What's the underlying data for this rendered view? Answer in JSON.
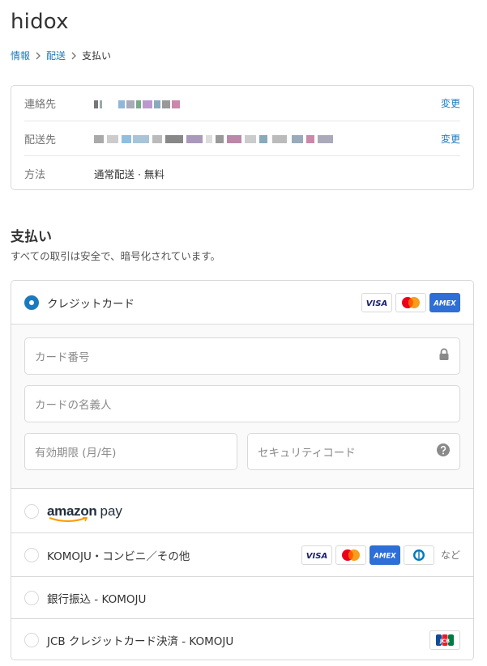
{
  "store": {
    "name": "hidox"
  },
  "breadcrumb": {
    "items": [
      "情報",
      "配送"
    ],
    "current": "支払い"
  },
  "review": {
    "contact_label": "連絡先",
    "ship_label": "配送先",
    "method_label": "方法",
    "method_value": "通常配送 · 無料",
    "change_label": "変更"
  },
  "payment": {
    "title": "支払い",
    "subtitle": "すべての取引は安全で、暗号化されています。",
    "credit_card_label": "クレジットカード",
    "card_number_placeholder": "カード番号",
    "card_name_placeholder": "カードの名義人",
    "expiry_placeholder": "有効期限 (月/年)",
    "security_code_placeholder": "セキュリティコード",
    "amazon_pay": {
      "brand": "amazon",
      "suffix": "pay"
    },
    "komoju_label": "KOMOJU・コンビニ／その他",
    "komoju_more": "など",
    "bank_label": "銀行振込 - KOMOJU",
    "jcb_label": "JCB クレジットカード決済 - KOMOJU",
    "card_brands": [
      "VISA",
      "mastercard",
      "AMEX",
      "diners",
      "JCB"
    ]
  },
  "colors": {
    "accent": "#197bbd",
    "border": "#d9d9d9",
    "visa": "#1a1f71",
    "amex": "#2d6fd6"
  }
}
